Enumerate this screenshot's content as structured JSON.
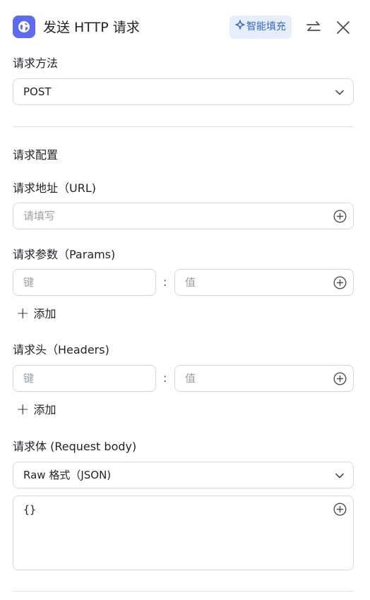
{
  "header": {
    "title": "发送 HTTP 请求",
    "smart_fill_label": "智能填充",
    "accent_color": "#5b6cf0"
  },
  "method": {
    "label": "请求方法",
    "value": "POST"
  },
  "config": {
    "section_title": "请求配置",
    "url": {
      "label": "请求地址（URL)",
      "placeholder": "请填写"
    },
    "params": {
      "label": "请求参数（Params)",
      "key_placeholder": "键",
      "value_placeholder": "值",
      "separator": ":",
      "add_label": "添加"
    },
    "headers": {
      "label": "请求头（Headers)",
      "key_placeholder": "键",
      "value_placeholder": "值",
      "separator": ":",
      "add_label": "添加"
    },
    "body": {
      "label": "请求体 (Request body)",
      "format": "Raw 格式（JSON)",
      "content": "{}"
    }
  }
}
